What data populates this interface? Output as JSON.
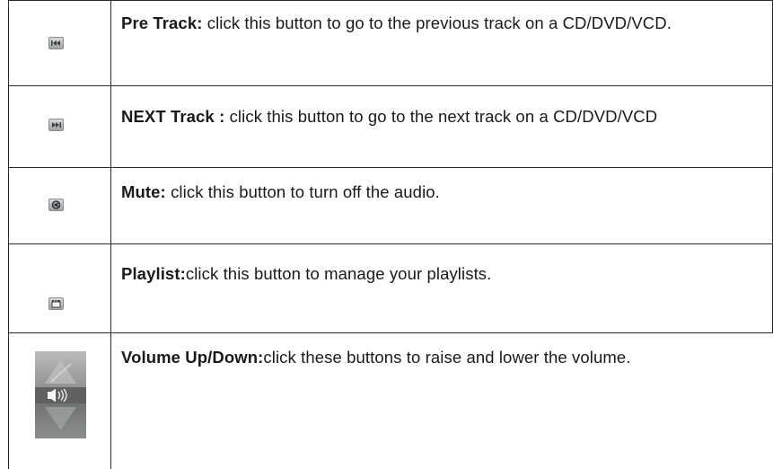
{
  "rows": [
    {
      "name": "pre-track",
      "icon": "previous-track-icon",
      "term": "Pre Track:",
      "description": " click this button to go to the previous track on a CD/DVD/VCD."
    },
    {
      "name": "next-track",
      "icon": "next-track-icon",
      "term": "NEXT Track :",
      "description": " click this button  to go to the next track on a CD/DVD/VCD"
    },
    {
      "name": "mute",
      "icon": "mute-icon",
      "term": "Mute:",
      "description": " click this button to turn off the audio."
    },
    {
      "name": "playlist",
      "icon": "playlist-icon",
      "term": "Playlist:",
      "description": "click this button to manage your playlists."
    },
    {
      "name": "volume",
      "icon": "volume-icon",
      "term": "Volume Up/Down:",
      "description": "click these buttons to raise and lower the volume."
    }
  ],
  "colors": {
    "border": "#2a2a2a",
    "text": "#1a1a1a",
    "icon_face": "#b8bcbc"
  }
}
